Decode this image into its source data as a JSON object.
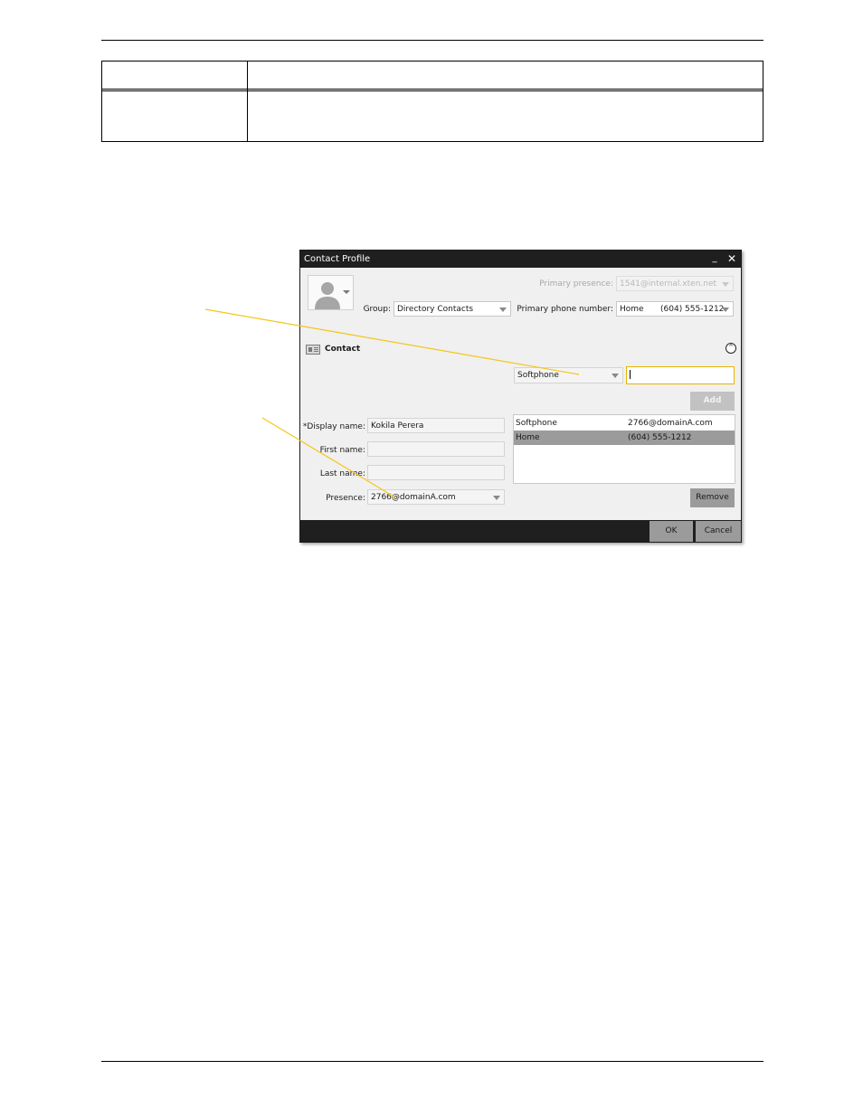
{
  "dialog": {
    "title": "Contact Profile",
    "minimize_symbol": "_",
    "close_symbol": "✕",
    "avatar_icon": "person-silhouette-icon",
    "group_label": "Group:",
    "group_value": "Directory Contacts",
    "primary_presence_label": "Primary presence:",
    "primary_presence_value": "1541@internal.xten.net",
    "primary_phone_label": "Primary phone number:",
    "primary_phone_type": "Home",
    "primary_phone_value": "(604) 555-1212",
    "section_title": "Contact",
    "section_icon": "contact-card-icon",
    "collapse_symbol": "^",
    "contact_type_value": "Softphone",
    "contact_value_input": "",
    "add_label": "Add",
    "display_name_label": "*Display name:",
    "display_name_value": "Kokila Perera",
    "first_name_label": "First name:",
    "first_name_value": "",
    "last_name_label": "Last name:",
    "last_name_value": "",
    "presence_label": "Presence:",
    "presence_value": "2766@domainA.com",
    "contact_list": [
      {
        "type": "Softphone",
        "value": "2766@domainA.com",
        "selected": false
      },
      {
        "type": "Home",
        "value": "(604) 555-1212",
        "selected": true
      }
    ],
    "remove_label": "Remove",
    "ok_label": "OK",
    "cancel_label": "Cancel"
  },
  "colors": {
    "callout_line": "#f5c518",
    "title_bar": "#1f1f1f",
    "selection": "#9b9b9b",
    "focus_border": "#e8b400"
  }
}
